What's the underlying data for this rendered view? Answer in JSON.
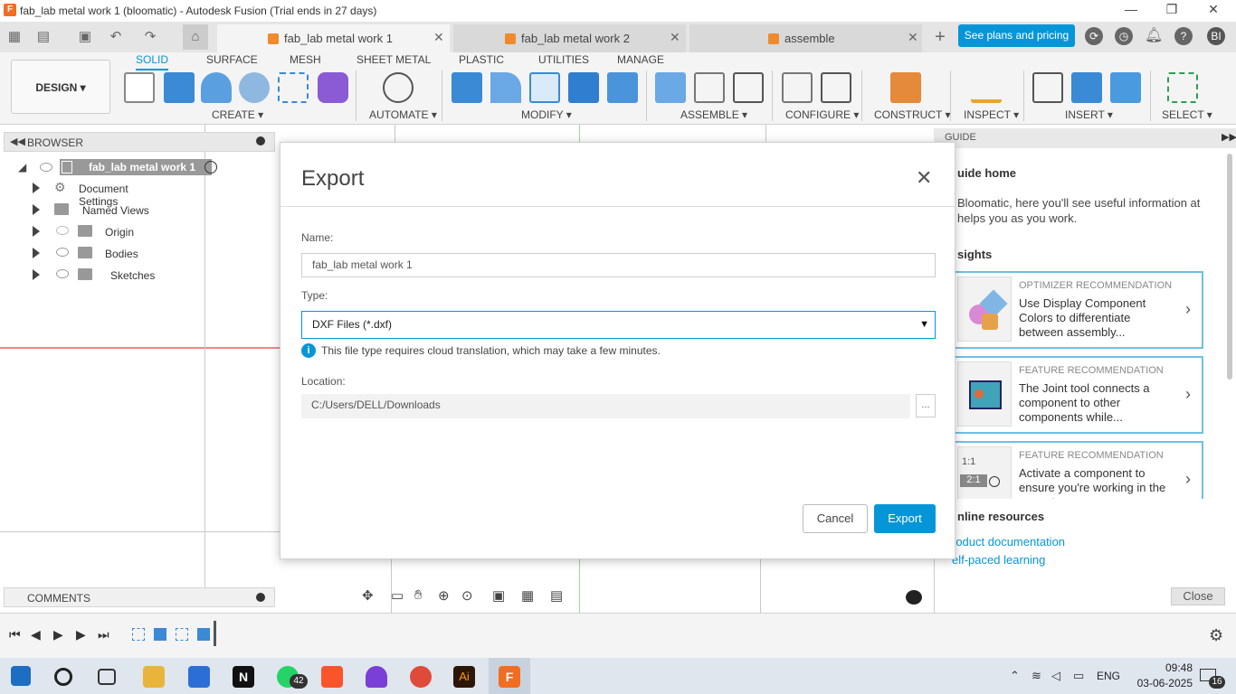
{
  "window": {
    "title": "fab_lab metal work 1 (bloomatic) - Autodesk Fusion (Trial ends in 27 days)",
    "app_icon_letter": "F",
    "controls": {
      "minimize": "—",
      "restore": "❐",
      "close": "✕"
    }
  },
  "doc_tabs": [
    {
      "label": "fab_lab metal work 1",
      "active": true
    },
    {
      "label": "fab_lab metal work 2",
      "active": false
    },
    {
      "label": "assemble",
      "active": false
    }
  ],
  "header": {
    "plans_button": "See plans and pricing",
    "user_initials": "BI"
  },
  "ribbon": {
    "workspace": "DESIGN ▾",
    "tabs": [
      "SOLID",
      "SURFACE",
      "MESH",
      "SHEET METAL",
      "PLASTIC",
      "UTILITIES",
      "MANAGE"
    ],
    "groups": [
      "CREATE ▾",
      "AUTOMATE ▾",
      "MODIFY ▾",
      "ASSEMBLE ▾",
      "CONFIGURE ▾",
      "CONSTRUCT ▾",
      "INSPECT ▾",
      "INSERT ▾",
      "SELECT ▾"
    ]
  },
  "browser": {
    "title": "BROWSER",
    "root": "fab_lab metal work 1",
    "items": [
      "Document Settings",
      "Named Views",
      "Origin",
      "Bodies",
      "Sketches"
    ]
  },
  "comments": {
    "title": "COMMENTS"
  },
  "dialog": {
    "title": "Export",
    "name_label": "Name:",
    "name_value": "fab_lab metal work 1",
    "type_label": "Type:",
    "type_value": "DXF Files (*.dxf)",
    "info_text": "This file type requires cloud translation, which may take a few minutes.",
    "location_label": "Location:",
    "location_value": "C:/Users/DELL/Downloads",
    "browse_label": "...",
    "cancel": "Cancel",
    "export": "Export"
  },
  "guide": {
    "header": "GUIDE",
    "home_title": "uide home",
    "intro": "Bloomatic, here you'll see useful information at helps you as you work.",
    "insights_title": "sights",
    "cards": [
      {
        "category": "OPTIMIZER RECOMMENDATION",
        "text": "Use Display Component Colors to differentiate between assembly..."
      },
      {
        "category": "FEATURE RECOMMENDATION",
        "text": "The Joint tool connects a component to other components while..."
      },
      {
        "category": "FEATURE RECOMMENDATION",
        "text": "Activate a component to ensure you're working in the correct c..."
      }
    ],
    "online_title": "nline resources",
    "links": [
      "roduct documentation",
      "elf-paced learning"
    ],
    "close": "Close"
  },
  "taskbar": {
    "time": "09:48",
    "date": "03-06-2025",
    "lang": "ENG",
    "whatsapp_badge": "42",
    "notif_badge": "16"
  },
  "colors": {
    "accent": "#0696d7",
    "fusion_orange": "#f26d21",
    "taskbar": "#dfe6ee"
  }
}
